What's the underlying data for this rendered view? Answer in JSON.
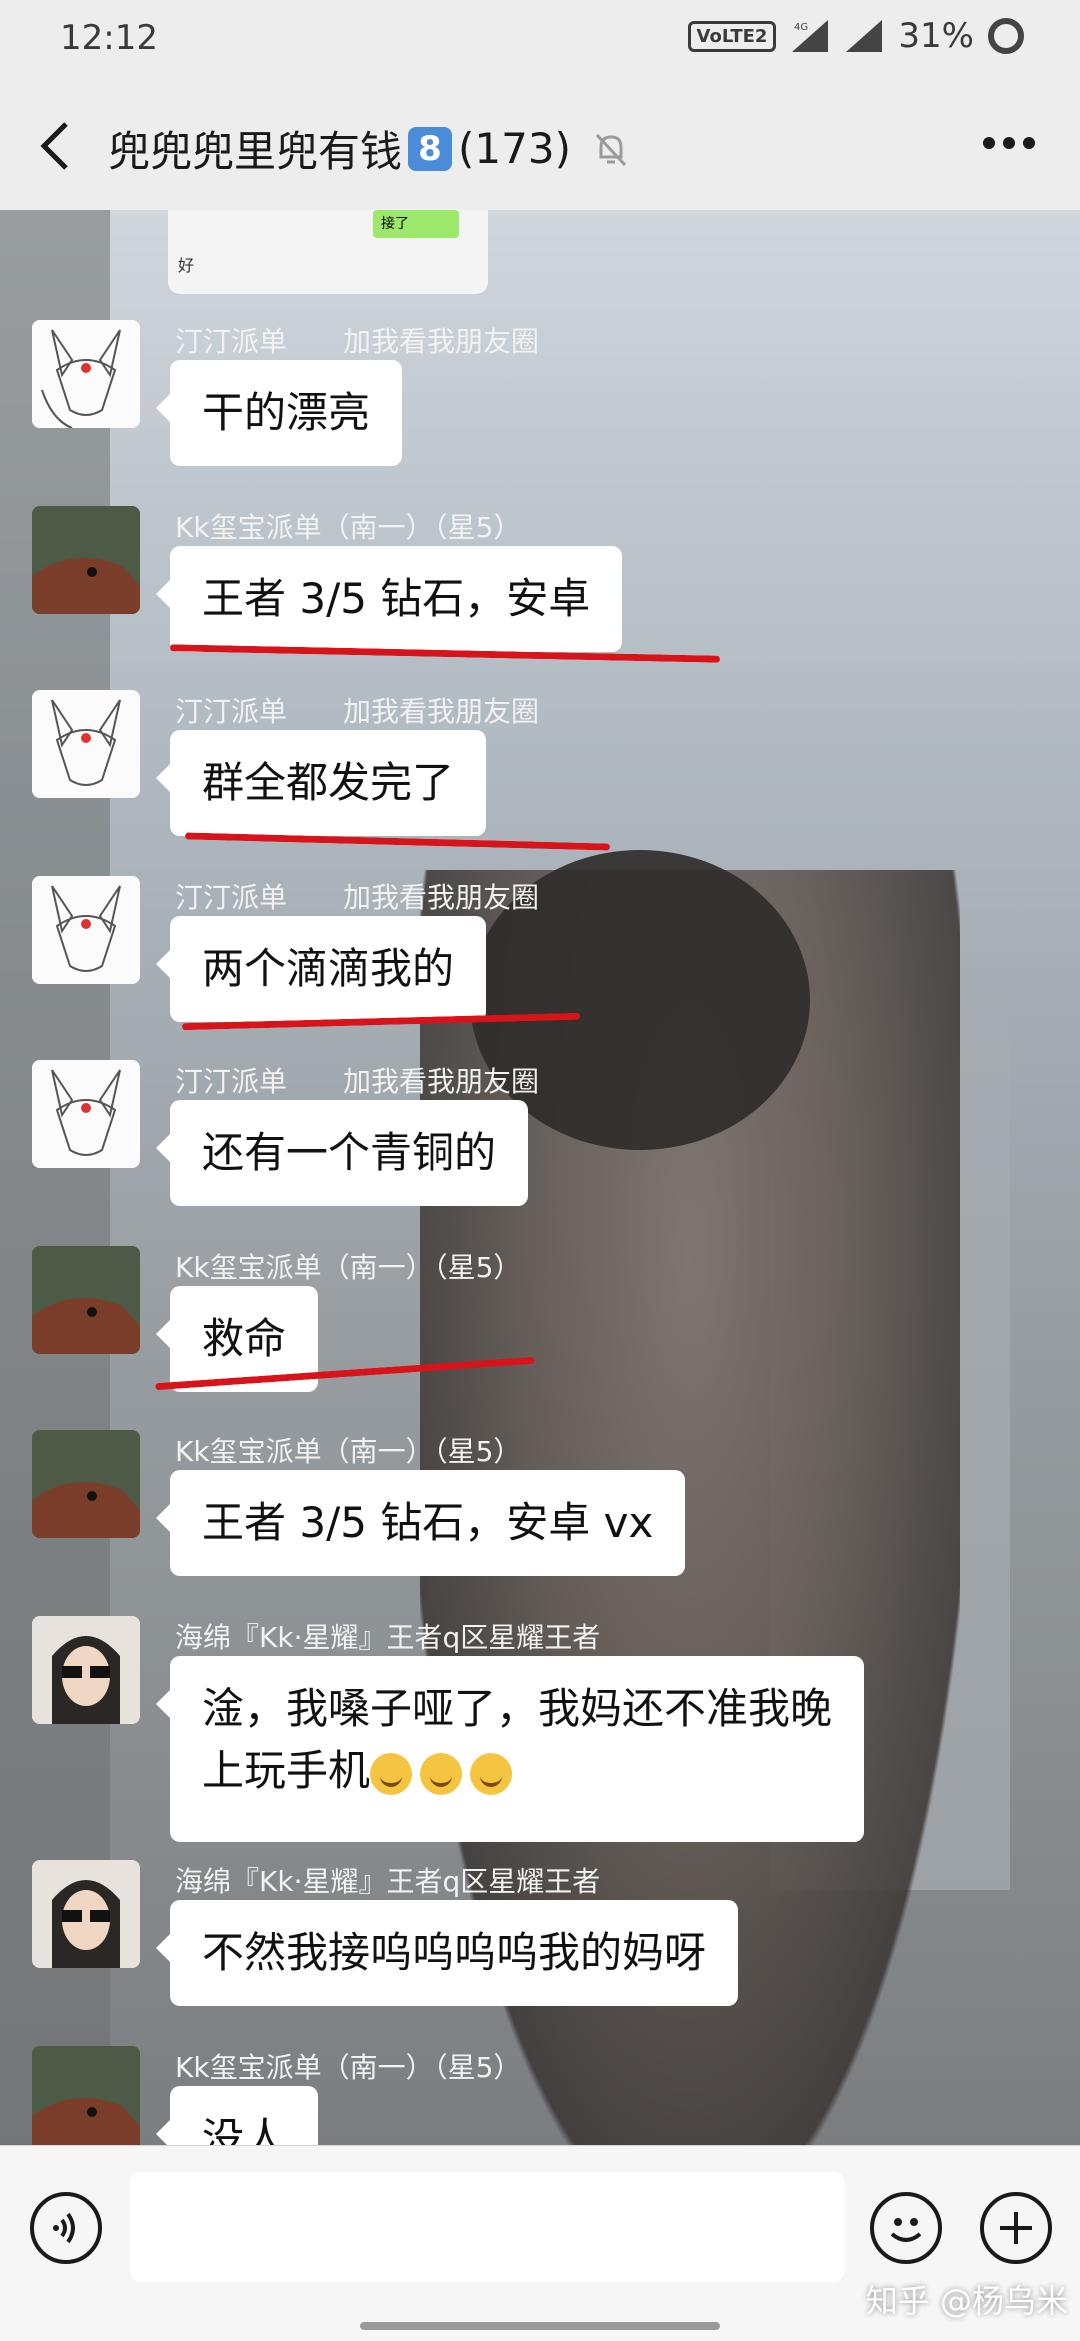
{
  "status": {
    "time": "12:12",
    "network": "VoLTE2",
    "net_type": "4G",
    "battery": "31%"
  },
  "header": {
    "title": "兜兜兜里兜有钱",
    "badge": "8",
    "count": "(173)"
  },
  "previous": {
    "reply": "好",
    "tag": "接了"
  },
  "messages": [
    {
      "sender": "汀汀派单",
      "note": "加我看我朋友圈",
      "text": "干的漂亮",
      "avatar": "fox-avatar"
    },
    {
      "sender": "Kk玺宝派单（南一）（星5）",
      "note": "",
      "text": "王者 3/5   钻石，安卓",
      "avatar": "horse-avatar"
    },
    {
      "sender": "汀汀派单",
      "note": "加我看我朋友圈",
      "text": "群全都发完了",
      "avatar": "fox-avatar"
    },
    {
      "sender": "汀汀派单",
      "note": "加我看我朋友圈",
      "text": "两个滴滴我的",
      "avatar": "fox-avatar"
    },
    {
      "sender": "汀汀派单",
      "note": "加我看我朋友圈",
      "text": "还有一个青铜的",
      "avatar": "fox-avatar"
    },
    {
      "sender": "Kk玺宝派单（南一）（星5）",
      "note": "",
      "text": "救命",
      "avatar": "horse-avatar"
    },
    {
      "sender": "Kk玺宝派单（南一）（星5）",
      "note": "",
      "text": "王者 3/5   钻石，安卓 vx",
      "avatar": "horse-avatar"
    },
    {
      "sender": "海绵『Kk·星耀』王者q区星耀王者",
      "note": "",
      "text1": "淦，我嗓子哑了，我妈还不准我晚",
      "text2": "上玩手机",
      "avatar": "girl-avatar"
    },
    {
      "sender": "海绵『Kk·星耀』王者q区星耀王者",
      "note": "",
      "text": "不然我接呜呜呜呜我的妈呀",
      "avatar": "girl-avatar"
    },
    {
      "sender": "Kk玺宝派单（南一）（星5）",
      "note": "",
      "text": "没人",
      "avatar": "horse-avatar"
    }
  ],
  "watermark": "知乎 @杨乌米",
  "colors": {
    "underline": "#d8141a",
    "bubble": "#ffffff",
    "badge": "#4a8cd8"
  }
}
